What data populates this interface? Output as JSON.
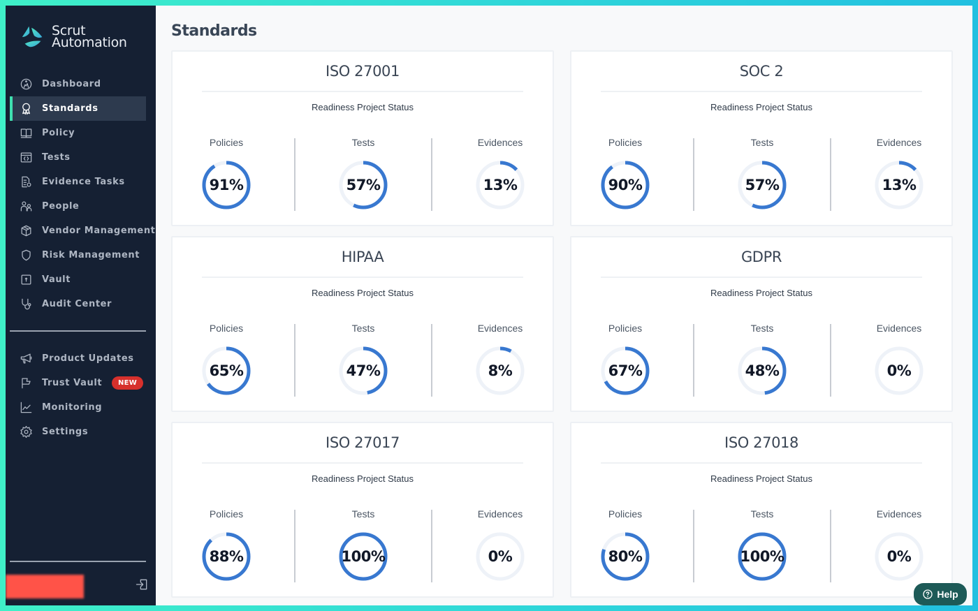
{
  "app": {
    "brand_line1": "Scrut",
    "brand_line2": "Automation"
  },
  "sidebar": {
    "items": [
      {
        "label": "Dashboard",
        "icon": "dashboard-icon",
        "active": false
      },
      {
        "label": "Standards",
        "icon": "award-icon",
        "active": true
      },
      {
        "label": "Policy",
        "icon": "book-icon",
        "active": false
      },
      {
        "label": "Tests",
        "icon": "code-window-icon",
        "active": false
      },
      {
        "label": "Evidence Tasks",
        "icon": "document-check-icon",
        "active": false
      },
      {
        "label": "People",
        "icon": "people-icon",
        "active": false
      },
      {
        "label": "Vendor Management",
        "icon": "box-icon",
        "active": false
      },
      {
        "label": "Risk Management",
        "icon": "shield-icon",
        "active": false
      },
      {
        "label": "Vault",
        "icon": "vault-icon",
        "active": false
      },
      {
        "label": "Audit Center",
        "icon": "stethoscope-icon",
        "active": false
      }
    ],
    "secondary_items": [
      {
        "label": "Product Updates",
        "icon": "megaphone-icon"
      },
      {
        "label": "Trust Vault",
        "icon": "flag-icon",
        "badge": "NEW"
      },
      {
        "label": "Monitoring",
        "icon": "chart-line-icon"
      },
      {
        "label": "Settings",
        "icon": "gear-icon"
      }
    ],
    "logout_icon": "logout-icon"
  },
  "main": {
    "page_title": "Standards",
    "subtitle": "Readiness Project Status",
    "metric_labels": [
      "Policies",
      "Tests",
      "Evidences"
    ],
    "standards": [
      {
        "name": "ISO 27001",
        "policies": 91,
        "tests": 57,
        "evidences": 13
      },
      {
        "name": "SOC 2",
        "policies": 90,
        "tests": 57,
        "evidences": 13
      },
      {
        "name": "HIPAA",
        "policies": 65,
        "tests": 47,
        "evidences": 8
      },
      {
        "name": "GDPR",
        "policies": 67,
        "tests": 48,
        "evidences": 0
      },
      {
        "name": "ISO 27017",
        "policies": 88,
        "tests": 100,
        "evidences": 0
      },
      {
        "name": "ISO 27018",
        "policies": 80,
        "tests": 100,
        "evidences": 0
      }
    ]
  },
  "help": {
    "label": "Help"
  },
  "colors": {
    "accent": "#3878d0",
    "ring_track": "#eef2f8",
    "sidebar_bg": "#152033",
    "active_indicator": "#3fe0b0",
    "badge_new": "#d7302c",
    "help_bg": "#1d5a57"
  }
}
